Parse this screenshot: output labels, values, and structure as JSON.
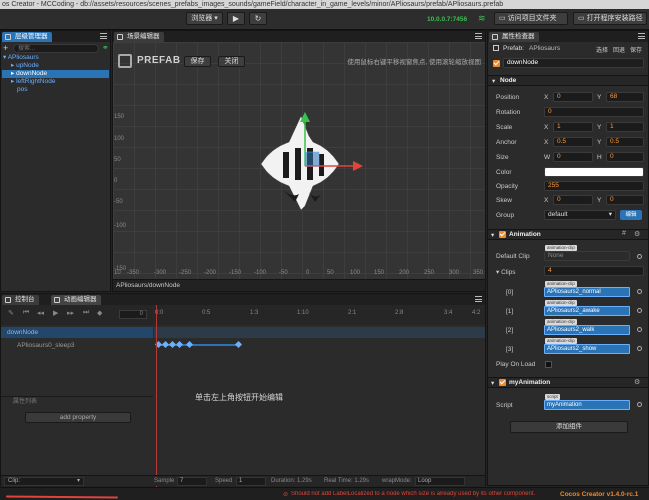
{
  "window": {
    "title": "os Creator - MCCoding - db://assets/resources/scenes_prefabs_images_sounds/gameField/character_in_game_levels/minor/APliosaurs/prefab/APliosaurs.prefab"
  },
  "toolbar": {
    "browser_label": "浏览器",
    "ip_address": "10.0.0.7:7456",
    "open_project_label": "访问项目文件夹",
    "open_app_label": "打开程序安装路径"
  },
  "hierarchy": {
    "tab_label": "层级管理器",
    "search_placeholder": "搜索...",
    "items": [
      {
        "label": "APliosaurs"
      },
      {
        "label": "upNode"
      },
      {
        "label": "downNode"
      },
      {
        "label": "leftRightNode"
      },
      {
        "label": "pos"
      }
    ]
  },
  "scene": {
    "tab_label": "场景编辑器",
    "prefab_label": "PREFAB",
    "save_label": "保存",
    "close_label": "关闭",
    "hint": "使用鼠标右键平移视窗焦点, 使用滚轮缩放视图",
    "x_ticks": [
      "-350",
      "-300",
      "-250",
      "-200",
      "-150",
      "-100",
      "-50",
      "0",
      "50",
      "100",
      "150",
      "200",
      "250",
      "300",
      "350"
    ],
    "y_ticks": [
      "150",
      "100",
      "50",
      "0",
      "-50",
      "-100",
      "-150"
    ],
    "corner_x": "10",
    "corner_y": "-150",
    "breadcrumb": "APliosaurs/downNode"
  },
  "bottom_tabs": {
    "console_label": "控制台",
    "animation_label": "动画编辑器"
  },
  "timeline": {
    "frame_value": "0",
    "ticks": [
      "0:0",
      "0:5",
      "1:3",
      "1:10",
      "2:1",
      "2:8",
      "3:4",
      "4:2"
    ],
    "node_label": "downNode",
    "property_label": "APliosaurs0_sleep3",
    "property_list_label": "属性列表",
    "add_property_label": "add property",
    "center_message": "单击左上角按钮开始编辑"
  },
  "statusbar": {
    "clip_label": "Clip:",
    "sample_label": "Sample",
    "sample_value": "7",
    "speed_label": "Speed",
    "speed_value": "1",
    "duration": "Duration: 1.29s",
    "real_time": "Real Time: 1.29s",
    "wrap_mode_label": "wrapMode:",
    "wrap_mode_value": "Loop",
    "error": "Should not add LabelLocalized to a node which size is already used by its other component.",
    "version": "Cocos Creator v1.4.0-rc.1"
  },
  "inspector": {
    "tab_label": "属性检查器",
    "prefab_label": "Prefab:",
    "prefab_name": "APliosaurs",
    "prefab_select": "选择",
    "prefab_revert": "回退",
    "prefab_save": "保存",
    "node_name": "downNode",
    "node_section": "Node",
    "position_label": "Position",
    "position": {
      "x": "0",
      "y": "68"
    },
    "rotation_label": "Rotation",
    "rotation": "0",
    "scale_label": "Scale",
    "scale": {
      "x": "1",
      "y": "1"
    },
    "anchor_label": "Anchor",
    "anchor": {
      "x": "0.5",
      "y": "0.5"
    },
    "size_label": "Size",
    "size": {
      "w": "0",
      "h": "0"
    },
    "color_label": "Color",
    "color_value": "#ffffff",
    "opacity_label": "Opacity",
    "opacity": "255",
    "skew_label": "Skew",
    "skew": {
      "x": "0",
      "y": "0"
    },
    "group_label": "Group",
    "group_value": "default",
    "group_edit": "编辑",
    "axis_x": "X",
    "axis_y": "Y",
    "axis_w": "W",
    "axis_h": "H",
    "animation_section": "Animation",
    "default_clip_label": "Default Clip",
    "default_clip_tag": "animation-clip",
    "default_clip_value": "None",
    "clips_label": "Clips",
    "clips_count": "4",
    "clip_tag": "animation-clip",
    "clips": [
      {
        "index": "[0]",
        "name": "APliosaurs2_normal"
      },
      {
        "index": "[1]",
        "name": "APliosaurs2_awake"
      },
      {
        "index": "[2]",
        "name": "APliosaurs2_walk"
      },
      {
        "index": "[3]",
        "name": "APliosaurs2_show"
      }
    ],
    "play_on_load_label": "Play On Load",
    "my_animation_section": "myAnimation",
    "script_label": "Script",
    "script_tag": "script",
    "script_value": "myAnimation",
    "add_component_label": "添加组件"
  },
  "colors": {
    "accent": "#2a73b5",
    "orange": "#f08b2b",
    "error": "#e0443b",
    "ok": "#39c24c"
  }
}
